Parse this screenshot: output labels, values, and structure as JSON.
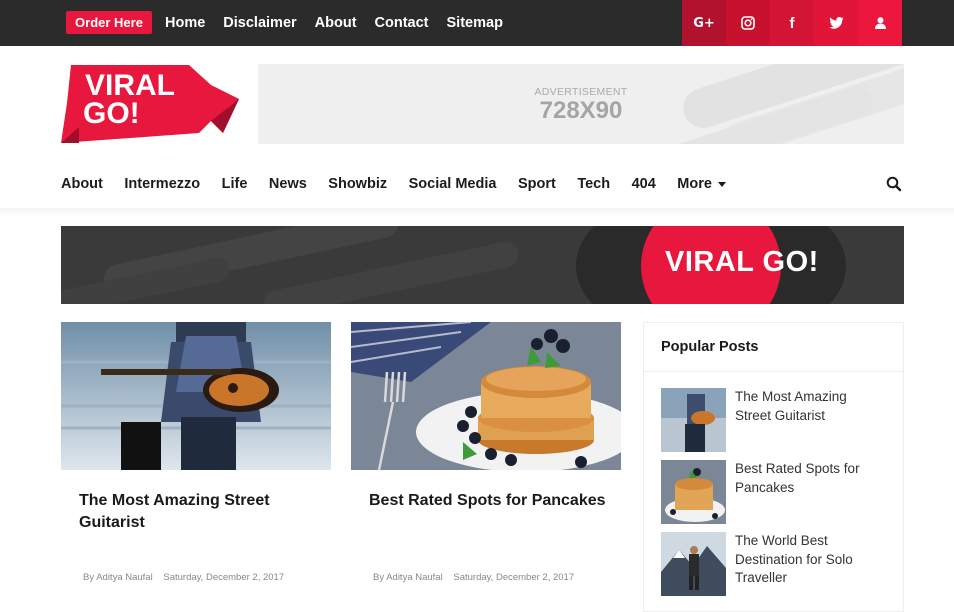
{
  "topbar": {
    "order_button": "Order Here",
    "links": [
      "Home",
      "Disclaimer",
      "About",
      "Contact",
      "Sitemap"
    ],
    "social": [
      {
        "icon": "google-plus-icon",
        "glyph": "G+",
        "color": "#b3122e"
      },
      {
        "icon": "instagram-icon",
        "glyph": "◎",
        "color": "#c8102f"
      },
      {
        "icon": "facebook-icon",
        "glyph": "f",
        "color": "#d41434"
      },
      {
        "icon": "twitter-icon",
        "glyph": "🐦",
        "color": "#e01538"
      },
      {
        "icon": "user-icon",
        "glyph": "👤",
        "color": "#ec173d"
      }
    ]
  },
  "header": {
    "logo_line1": "VIRAL",
    "logo_line2": "GO!",
    "ad_label": "ADVERTISEMENT",
    "ad_size": "728X90"
  },
  "nav": {
    "items": [
      "About",
      "Intermezzo",
      "Life",
      "News",
      "Showbiz",
      "Social Media",
      "Sport",
      "Tech",
      "404"
    ],
    "more": "More"
  },
  "banner": {
    "text": "VIRAL GO!"
  },
  "posts": [
    {
      "title": "The Most Amazing Street Guitarist",
      "author": "By Aditya Naufal",
      "date": "Saturday, December 2, 2017"
    },
    {
      "title": "Best Rated Spots for Pancakes",
      "author": "By Aditya Naufal",
      "date": "Saturday, December 2, 2017"
    }
  ],
  "sidebar": {
    "heading": "Popular Posts",
    "items": [
      {
        "title": "The Most Amazing Street Guitarist"
      },
      {
        "title": "Best Rated Spots for Pancakes"
      },
      {
        "title": "The World Best Destination for Solo Traveller"
      }
    ]
  },
  "colors": {
    "accent": "#e8173d",
    "topbar": "#2b2b2b"
  }
}
